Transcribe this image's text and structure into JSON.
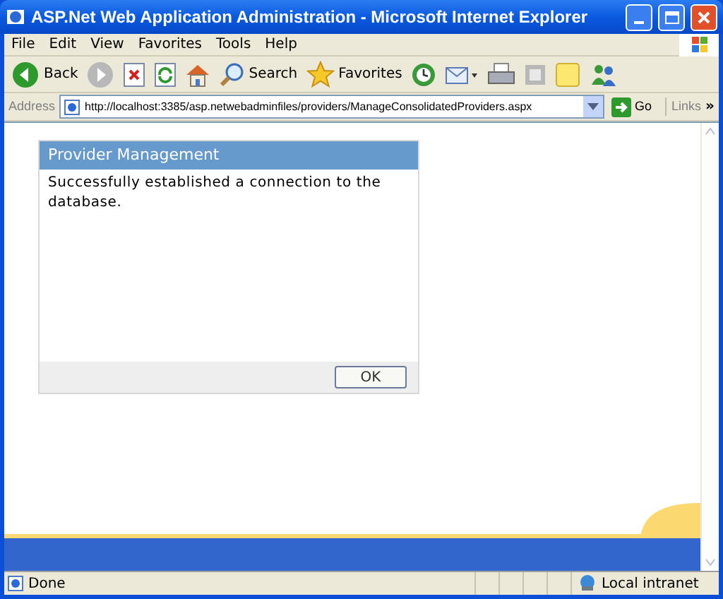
{
  "window": {
    "title": "ASP.Net Web Application Administration - Microsoft Internet Explorer"
  },
  "menu": [
    "File",
    "Edit",
    "View",
    "Favorites",
    "Tools",
    "Help"
  ],
  "toolbar": [
    {
      "kind": "back",
      "label": "Back",
      "disabled": false
    },
    {
      "kind": "forward",
      "disabled": true
    },
    {
      "kind": "stop",
      "disabled": false
    },
    {
      "kind": "refresh",
      "disabled": false
    },
    {
      "kind": "home",
      "disabled": false
    },
    {
      "kind": "search",
      "label": "Search",
      "disabled": false
    },
    {
      "kind": "favorites",
      "label": "Favorites",
      "disabled": false
    },
    {
      "kind": "history",
      "disabled": false
    },
    {
      "kind": "mail",
      "disabled": false
    },
    {
      "kind": "print",
      "disabled": false
    },
    {
      "kind": "edit",
      "disabled": true
    },
    {
      "kind": "note",
      "disabled": false
    },
    {
      "kind": "messenger",
      "disabled": false
    }
  ],
  "address": {
    "label": "Address",
    "value": "http://localhost:3385/asp.netwebadminfiles/providers/ManageConsolidatedProviders.aspx",
    "go": "Go",
    "links": "Links",
    "more": "»"
  },
  "panel": {
    "title": "Provider Management",
    "message": "Successfully established a connection to the database.",
    "button": "OK"
  },
  "status_bar": {
    "text": "Done",
    "zone": "Local intranet"
  }
}
